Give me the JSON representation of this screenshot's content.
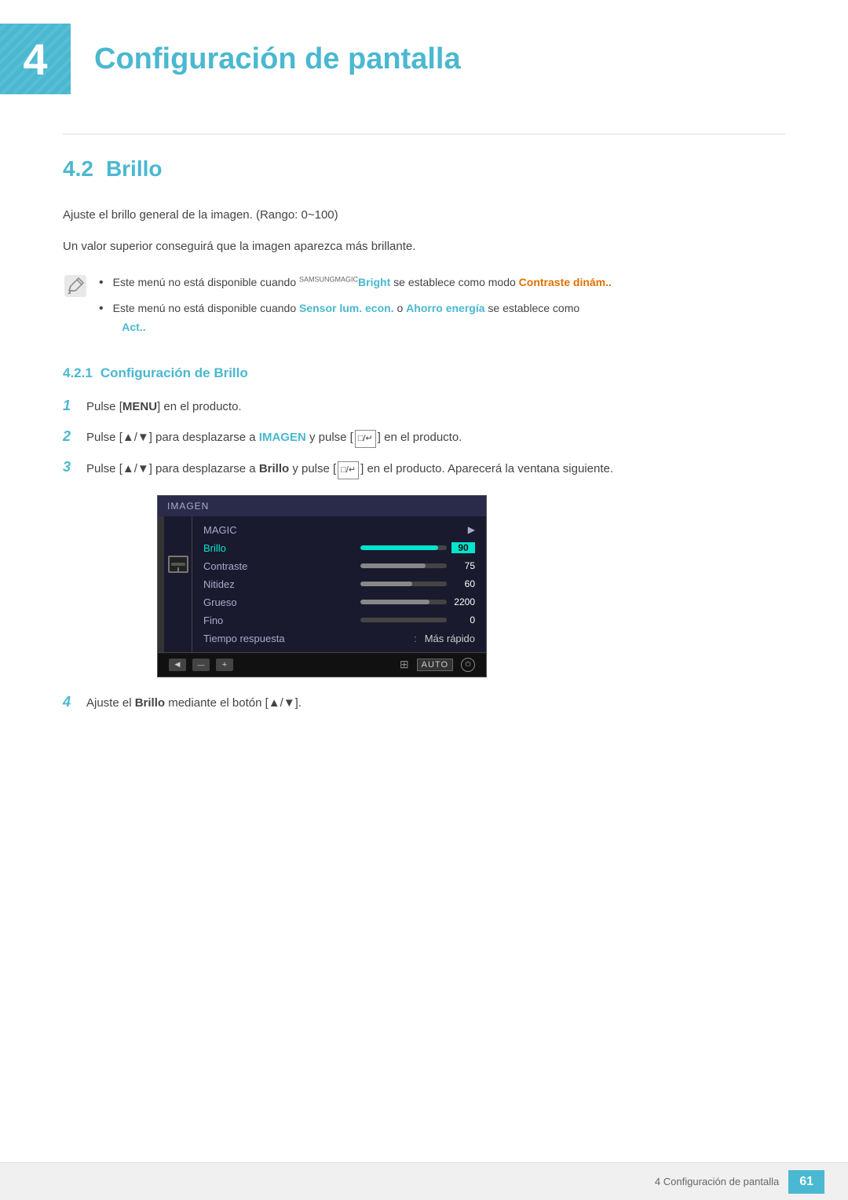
{
  "header": {
    "chapter_number": "4",
    "chapter_title": "Configuración de pantalla"
  },
  "section": {
    "number": "4.2",
    "title": "Brillo",
    "description1": "Ajuste el brillo general de la imagen. (Rango: 0~100)",
    "description2": "Un valor superior conseguirá que la imagen aparezca más brillante.",
    "note1_prefix": "Este menú no está disponible cuando ",
    "note1_brand": "SAMSUNG",
    "note1_magic": "MAGIC",
    "note1_keyword": "Bright",
    "note1_suffix": " se establece como modo ",
    "note1_link": "Contraste dinám..",
    "note2_prefix": "Este menú no está disponible cuando ",
    "note2_keyword1": "Sensor lum. econ.",
    "note2_middle": " o ",
    "note2_keyword2": "Ahorro energía",
    "note2_suffix": " se establece como ",
    "note2_link": "Act..",
    "subsection_number": "4.2.1",
    "subsection_title": "Configuración de Brillo",
    "step1": "Pulse [MENU] en el producto.",
    "step1_key": "MENU",
    "step2_prefix": "Pulse [▲/▼] para desplazarse a ",
    "step2_bold": "IMAGEN",
    "step2_suffix": " y pulse [",
    "step2_suffix2": "] en el producto.",
    "step3_prefix": "Pulse [▲/▼] para desplazarse a ",
    "step3_bold": "Brillo",
    "step3_middle": " y pulse [",
    "step3_middle2": "] en el producto. Aparecerá la ventana siguiente.",
    "step4_prefix": "Ajuste el ",
    "step4_bold": "Brillo",
    "step4_suffix": " mediante el botón [▲/▼].",
    "menu": {
      "header": "IMAGEN",
      "items": [
        {
          "label": "MAGIC",
          "value_type": "arrow"
        },
        {
          "label": "Brillo",
          "value_type": "progress",
          "progress": 90,
          "num": "90",
          "active": true
        },
        {
          "label": "Contraste",
          "value_type": "progress",
          "progress": 75,
          "num": "75",
          "active": false
        },
        {
          "label": "Nitidez",
          "value_type": "progress",
          "progress": 60,
          "num": "60",
          "active": false
        },
        {
          "label": "Grueso",
          "value_type": "progress",
          "progress": 80,
          "num": "2200",
          "active": false
        },
        {
          "label": "Fino",
          "value_type": "progress",
          "progress": 0,
          "num": "0",
          "active": false
        },
        {
          "label": "Tiempo respuesta",
          "value_type": "text",
          "text": "Más rápido"
        }
      ]
    }
  },
  "footer": {
    "text": "4 Configuración de pantalla",
    "page": "61"
  }
}
